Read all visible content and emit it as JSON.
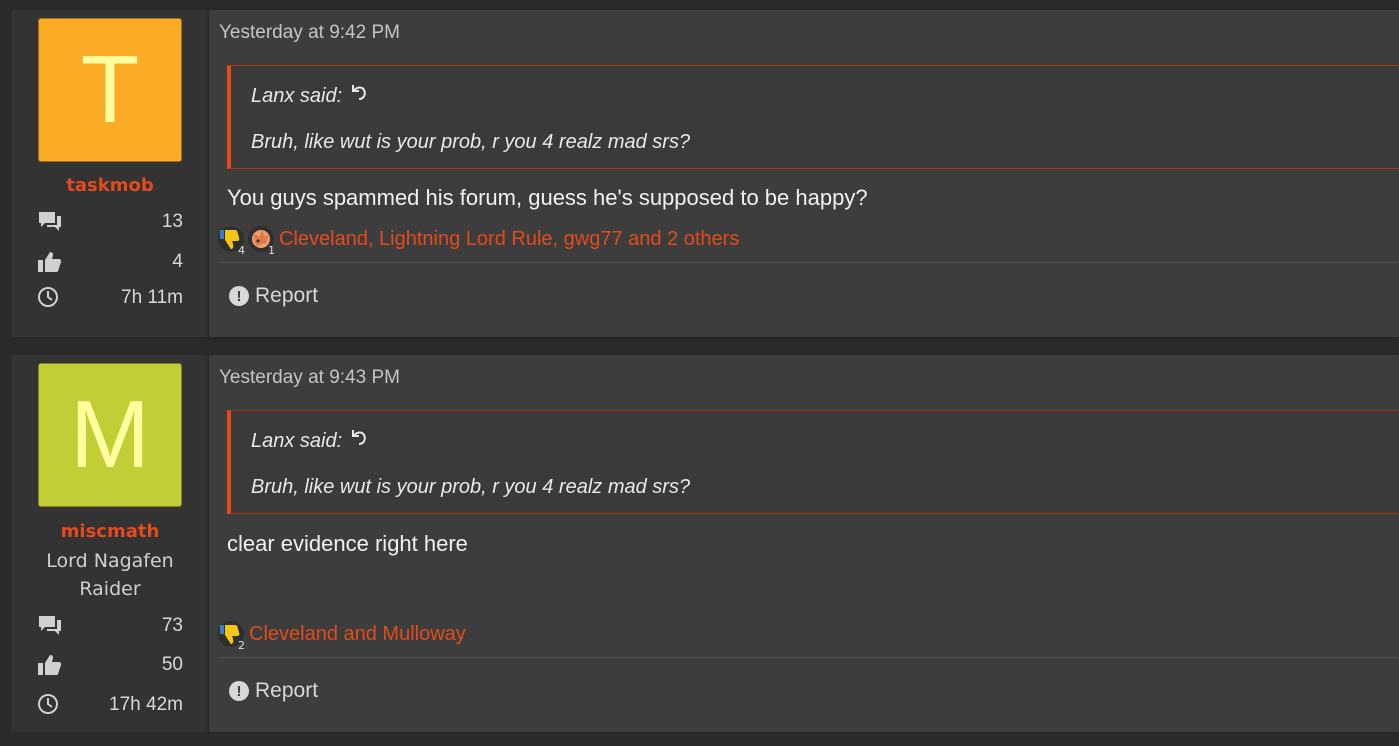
{
  "posts": [
    {
      "avatar_letter": "T",
      "avatar_bg": "#fbab25",
      "avatar_fg": "#ffffa0",
      "username": "taskmob",
      "user_title": "",
      "stats": {
        "messages": "13",
        "reactions": "4",
        "time": "7h 11m"
      },
      "timestamp": "Yesterday at 9:42 PM",
      "quote": {
        "author": "Lanx said:",
        "text": "Bruh, like wut is your prob, r you 4 realz mad srs?"
      },
      "message": "You guys spammed his forum, guess he's supposed to be happy?",
      "reactions": {
        "icons": [
          {
            "name": "thumbs-down",
            "count": "4"
          },
          {
            "name": "facepalm",
            "count": "1"
          }
        ],
        "list": "Cleveland, Lightning Lord Rule, gwg77 and 2 others"
      },
      "report_label": "Report"
    },
    {
      "avatar_letter": "M",
      "avatar_bg": "#c3cd35",
      "avatar_fg": "#ffffa0",
      "username": "miscmath",
      "user_title": "Lord Nagafen Raider",
      "user_title_line1": "Lord Nagafen",
      "user_title_line2": "Raider",
      "stats": {
        "messages": "73",
        "reactions": "50",
        "time": "17h 42m"
      },
      "timestamp": "Yesterday at 9:43 PM",
      "quote": {
        "author": "Lanx said:",
        "text": "Bruh, like wut is your prob, r you 4 realz mad srs?"
      },
      "message": "clear evidence right here",
      "reactions": {
        "icons": [
          {
            "name": "thumbs-down",
            "count": "2"
          }
        ],
        "list": "Cleveland and Mulloway"
      },
      "report_label": "Report"
    }
  ],
  "colors": {
    "accent": "#e34a1c",
    "page_bg": "#2a2a2a",
    "post_bg": "#3d3d3d"
  }
}
